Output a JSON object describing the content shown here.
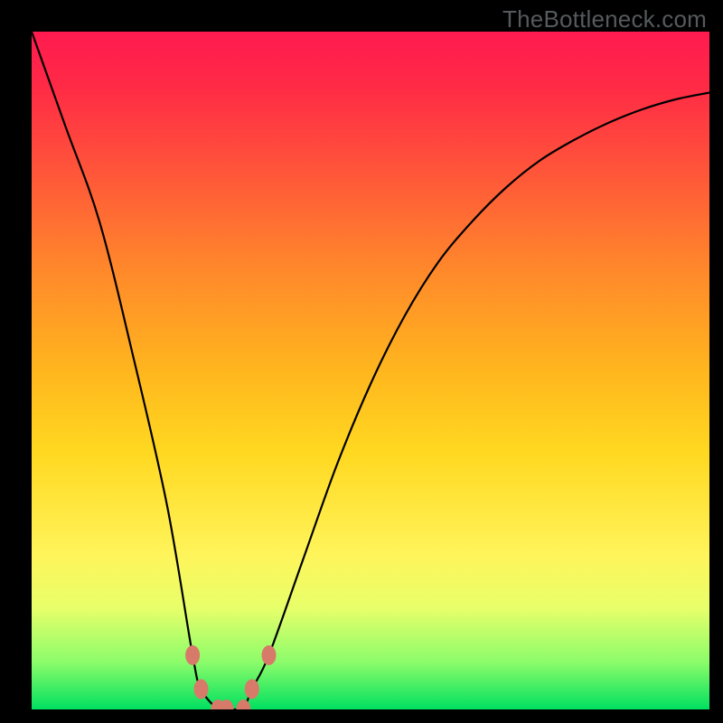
{
  "watermark": "TheBottleneck.com",
  "chart_data": {
    "type": "line",
    "x": [
      0,
      0.05,
      0.1,
      0.15,
      0.2,
      0.2375,
      0.25,
      0.275,
      0.2875,
      0.3,
      0.3125,
      0.325,
      0.35,
      0.4,
      0.45,
      0.5,
      0.55,
      0.6,
      0.65,
      0.7,
      0.75,
      0.8,
      0.85,
      0.9,
      0.95,
      1.0
    ],
    "bottleneck_percent": [
      100,
      86,
      72,
      52,
      30,
      8,
      3,
      0,
      0,
      0,
      0,
      3,
      8,
      22,
      36,
      48,
      58,
      66,
      72,
      77,
      81,
      84,
      86.5,
      88.5,
      90,
      91
    ],
    "title": "",
    "xlabel": "",
    "ylabel": "",
    "ylim": [
      0,
      100
    ],
    "xlim": [
      0,
      1
    ],
    "markers": [
      {
        "x": 0.2375,
        "bottleneck_percent": 8
      },
      {
        "x": 0.25,
        "bottleneck_percent": 3
      },
      {
        "x": 0.275,
        "bottleneck_percent": 0
      },
      {
        "x": 0.2875,
        "bottleneck_percent": 0
      },
      {
        "x": 0.3125,
        "bottleneck_percent": 0
      },
      {
        "x": 0.325,
        "bottleneck_percent": 3
      },
      {
        "x": 0.35,
        "bottleneck_percent": 8
      }
    ],
    "gradient_note": "background color maps bottleneck% — top is high (red), bottom is low (green)"
  }
}
